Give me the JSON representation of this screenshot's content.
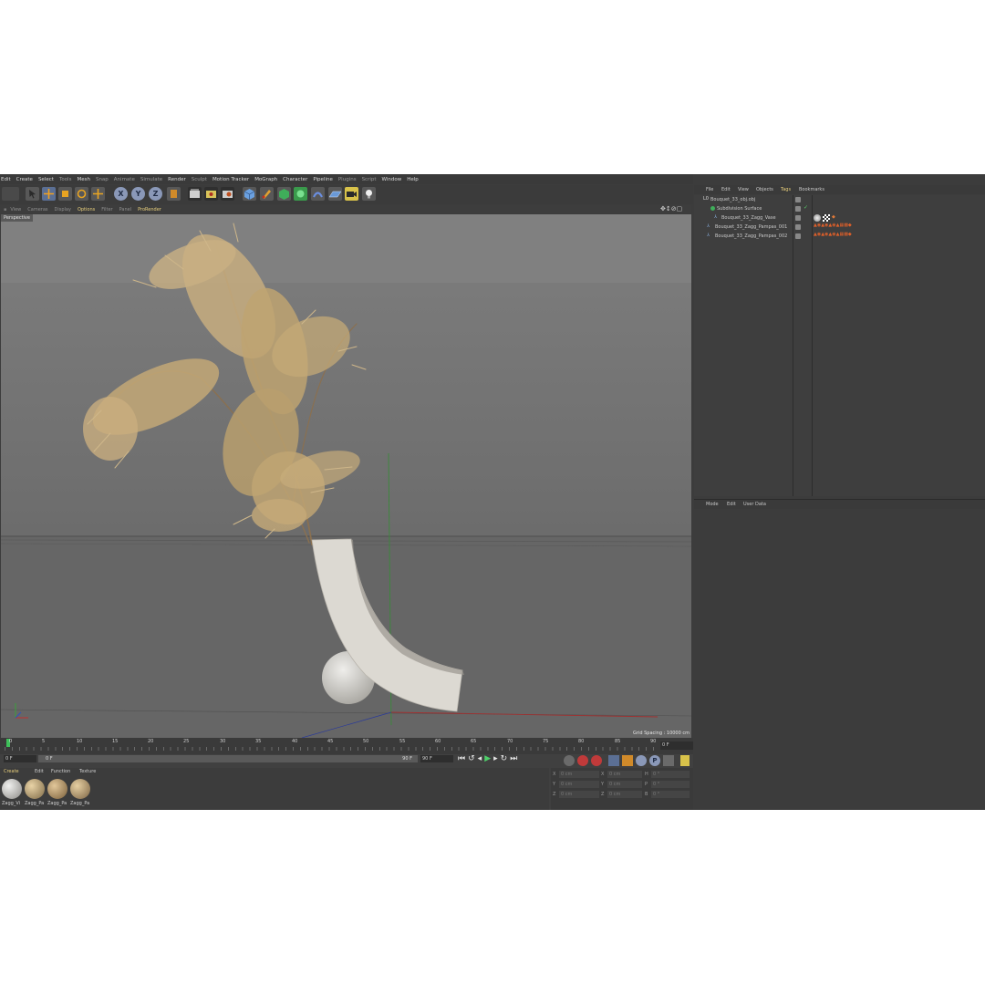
{
  "menu": [
    "Edit",
    "Create",
    "Select",
    "Tools",
    "Mesh",
    "Snap",
    "Animate",
    "Simulate",
    "Render",
    "Sculpt",
    "Motion Tracker",
    "MoGraph",
    "Character",
    "Pipeline",
    "Plugins",
    "Script",
    "Window",
    "Help"
  ],
  "viewport": {
    "menu": [
      "View",
      "Cameras",
      "Display",
      "Options",
      "Filter",
      "Panel",
      "ProRender"
    ],
    "camera_label": "Perspective",
    "grid_spacing": "Grid Spacing : 10000 cm"
  },
  "timeline": {
    "ticks": [
      "0",
      "5",
      "10",
      "15",
      "20",
      "25",
      "30",
      "35",
      "40",
      "45",
      "50",
      "55",
      "60",
      "65",
      "70",
      "75",
      "80",
      "85",
      "90"
    ],
    "current_frame": "0 F",
    "start_field": "0 F",
    "slider_start": "0 F",
    "slider_end": "90 F",
    "end_field": "90 F"
  },
  "material_manager": {
    "menu": [
      "Create",
      "Edit",
      "Function",
      "Texture"
    ],
    "materials": [
      "Zagg_Vi",
      "Zagg_Pa",
      "Zagg_Pa",
      "Zagg_Pa"
    ]
  },
  "coordinates": {
    "rows": [
      {
        "a": "X",
        "a_val": "0 cm",
        "b": "X",
        "b_val": "0 cm",
        "c": "H",
        "c_val": "0 °"
      },
      {
        "a": "Y",
        "a_val": "0 cm",
        "b": "Y",
        "b_val": "0 cm",
        "c": "P",
        "c_val": "0 °"
      },
      {
        "a": "Z",
        "a_val": "0 cm",
        "b": "Z",
        "b_val": "0 cm",
        "c": "B",
        "c_val": "0 °"
      }
    ]
  },
  "object_manager": {
    "menu": [
      "File",
      "Edit",
      "View",
      "Objects",
      "Tags",
      "Bookmarks"
    ],
    "objects": [
      {
        "name": "Bouquet_33_obj.obj",
        "indent": 0
      },
      {
        "name": "Subdivision Surface",
        "indent": 1
      },
      {
        "name": "Bouquet_33_Zagg_Vase",
        "indent": 2
      },
      {
        "name": "Bouquet_33_Zagg_Pampas_001",
        "indent": 1
      },
      {
        "name": "Bouquet_33_Zagg_Pampas_002",
        "indent": 1
      }
    ]
  },
  "attributes": {
    "menu": [
      "Mode",
      "Edit",
      "User Data"
    ]
  },
  "colors": {
    "accent": "#e8cf7c",
    "panel": "#3c3c3c",
    "viewport_bg": "#7c7c7c",
    "vase": "#dcd8d0",
    "pampas": "#bfa67a"
  }
}
